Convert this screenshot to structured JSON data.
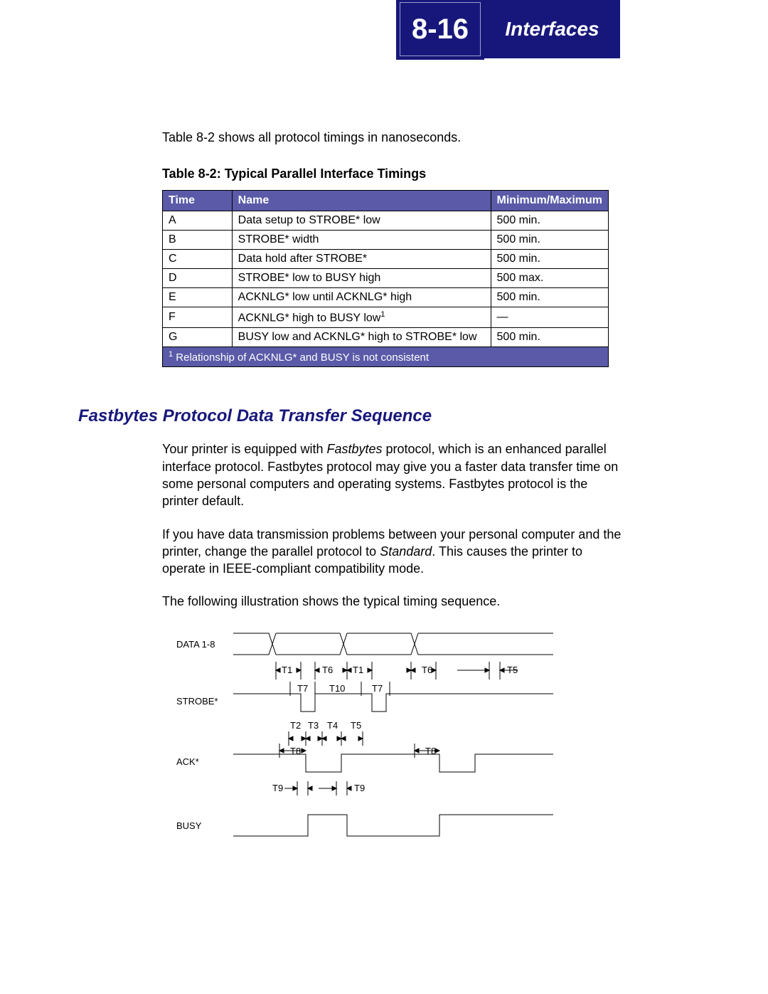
{
  "header": {
    "page_number": "8-16",
    "chapter_title": "Interfaces"
  },
  "intro_text": "Table 8-2 shows all protocol timings in nanoseconds.",
  "table": {
    "caption": "Table 8-2:  Typical Parallel Interface Timings",
    "columns": [
      "Time",
      "Name",
      "Minimum/Maximum"
    ],
    "rows": [
      {
        "time": "A",
        "name": "Data setup to STROBE* low",
        "minmax": "500 min."
      },
      {
        "time": "B",
        "name": "STROBE* width",
        "minmax": "500 min."
      },
      {
        "time": "C",
        "name": "Data hold after STROBE*",
        "minmax": "500 min."
      },
      {
        "time": "D",
        "name": "STROBE* low to BUSY high",
        "minmax": "500 max."
      },
      {
        "time": "E",
        "name": "ACKNLG* low until ACKNLG* high",
        "minmax": "500 min."
      },
      {
        "time": "F",
        "name": "ACKNLG* high to BUSY low",
        "name_sup": "1",
        "minmax": "—"
      },
      {
        "time": "G",
        "name": "BUSY low and ACKNLG* high to STROBE* low",
        "minmax": "500 min."
      }
    ],
    "footnote_sup": "1",
    "footnote": " Relationship of ACKNLG* and BUSY is not consistent"
  },
  "section_heading": "Fastbytes Protocol Data Transfer Sequence",
  "para1_a": "Your printer is equipped with ",
  "para1_em1": "Fastbytes",
  "para1_b": " protocol, which is an enhanced parallel interface protocol. Fastbytes protocol may give you a faster data transfer time on some personal computers and operating systems. Fastbytes protocol is the printer default.",
  "para2_a": "If you have data transmission problems between your personal computer and the printer, change the parallel protocol to ",
  "para2_em1": "Standard",
  "para2_b": ". This causes the printer to operate in IEEE-compliant compatibility mode.",
  "para3": "The following illustration shows the typical timing sequence.",
  "diagram": {
    "signals": [
      "DATA 1-8",
      "STROBE*",
      "ACK*",
      "BUSY"
    ],
    "timing_labels": [
      "T1",
      "T2",
      "T3",
      "T4",
      "T5",
      "T6",
      "T7",
      "T8",
      "T9",
      "T10"
    ]
  }
}
